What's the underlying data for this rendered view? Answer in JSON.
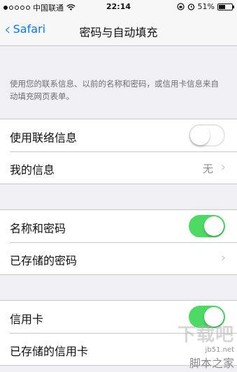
{
  "status_bar": {
    "carrier": "中国联通",
    "time": "22:14",
    "battery": "51%",
    "battery_level": 0.51,
    "wifi_icon": "wifi-icon",
    "rotation_lock_icon": "rotation-lock-icon",
    "alarm_icon": "alarm-icon"
  },
  "nav": {
    "back_label": "Safari",
    "title": "密码与自动填充"
  },
  "description": "使用您的联系信息、以前的名称和密码，或信用卡信息来自动填充网页表单。",
  "groups": [
    {
      "rows": [
        {
          "label": "使用联络信息",
          "type": "toggle",
          "on": false
        },
        {
          "label": "我的信息",
          "type": "link",
          "value": "无"
        }
      ]
    },
    {
      "rows": [
        {
          "label": "名称和密码",
          "type": "toggle",
          "on": true
        },
        {
          "label": "已存储的密码",
          "type": "link"
        }
      ]
    },
    {
      "rows": [
        {
          "label": "信用卡",
          "type": "toggle",
          "on": true
        },
        {
          "label": "已存储的信用卡",
          "type": "link"
        }
      ]
    }
  ],
  "colors": {
    "accent": "#007aff",
    "toggle_on": "#4cd964",
    "background": "#efeff4"
  },
  "watermark": {
    "logo": "下载吧",
    "site": "jb51.net",
    "name": "脚本之家"
  }
}
